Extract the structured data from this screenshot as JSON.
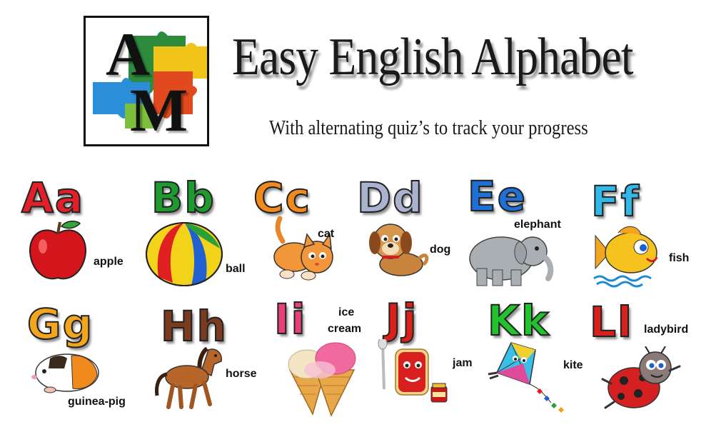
{
  "header": {
    "logo_letters": [
      "A",
      "M"
    ],
    "title": "Easy English Alphabet",
    "subtitle": "With alternating quiz’s to track your progress"
  },
  "cards": [
    {
      "letters": "Aa",
      "word": "apple",
      "color": "#e3202a",
      "icon": "apple-icon"
    },
    {
      "letters": "Bb",
      "word": "ball",
      "color": "#1f9a2e",
      "icon": "ball-icon"
    },
    {
      "letters": "Cc",
      "word": "cat",
      "color": "#f08a1c",
      "icon": "cat-icon"
    },
    {
      "letters": "Dd",
      "word": "dog",
      "color": "#8f9bbd",
      "icon": "dog-icon"
    },
    {
      "letters": "Ee",
      "word": "elephant",
      "color": "#1e6fd6",
      "icon": "elephant-icon"
    },
    {
      "letters": "Ff",
      "word": "fish",
      "color": "#2fb8e8",
      "icon": "fish-icon"
    },
    {
      "letters": "Gg",
      "word": "guinea-pig",
      "color": "#f2a51e",
      "icon": "guinea-pig-icon"
    },
    {
      "letters": "Hh",
      "word": "horse",
      "color": "#7a3b1e",
      "icon": "horse-icon"
    },
    {
      "letters": "Ii",
      "word_line1": "ice",
      "word_line2": "cream",
      "color": "#e6417a",
      "icon": "ice-cream-icon"
    },
    {
      "letters": "Jj",
      "word": "jam",
      "color": "#d9201b",
      "icon": "jam-icon"
    },
    {
      "letters": "Kk",
      "word": "kite",
      "color": "#22c22e",
      "icon": "kite-icon"
    },
    {
      "letters": "Ll",
      "word": "ladybird",
      "color": "#d9201b",
      "icon": "ladybird-icon"
    }
  ]
}
